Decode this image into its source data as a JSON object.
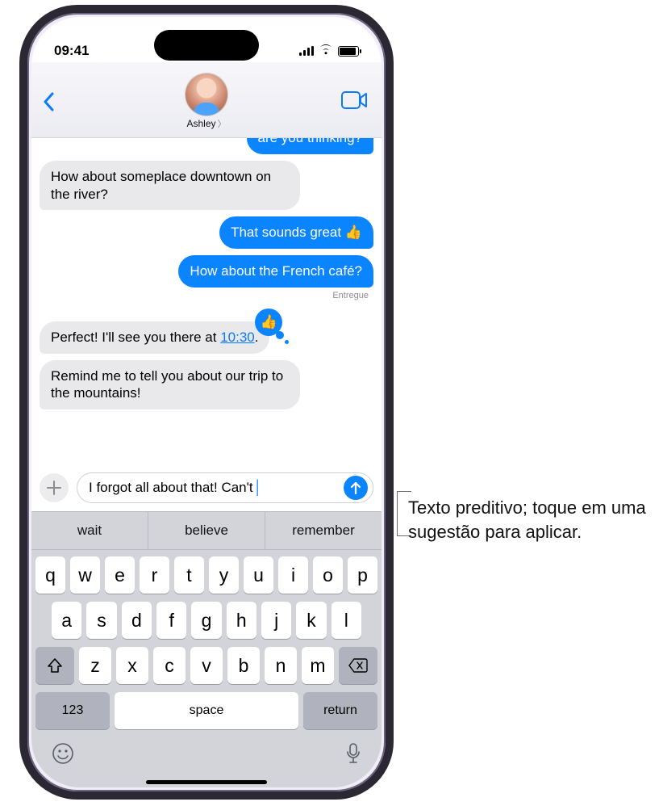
{
  "status": {
    "time": "09:41"
  },
  "nav": {
    "contact_name": "Ashley"
  },
  "messages": {
    "m0": "are you thinking?",
    "m1": "How about someplace downtown on the river?",
    "m2_pre": "That sounds great ",
    "m3": "How about the French café?",
    "delivered": "Entregue",
    "m4_pre": "Perfect! I'll see you there at ",
    "m4_time": "10:30",
    "m4_post": ".",
    "m5": "Remind me to tell you about our trip to the mountains!"
  },
  "compose": {
    "text": "I forgot all about that! Can't"
  },
  "predictions": {
    "s1": "wait",
    "s2": "believe",
    "s3": "remember"
  },
  "keyboard": {
    "row1": [
      "q",
      "w",
      "e",
      "r",
      "t",
      "y",
      "u",
      "i",
      "o",
      "p"
    ],
    "row2": [
      "a",
      "s",
      "d",
      "f",
      "g",
      "h",
      "j",
      "k",
      "l"
    ],
    "row3": [
      "z",
      "x",
      "c",
      "v",
      "b",
      "n",
      "m"
    ],
    "num": "123",
    "space": "space",
    "ret": "return"
  },
  "callout": {
    "text": "Texto preditivo; toque em uma sugestão para aplicar."
  }
}
